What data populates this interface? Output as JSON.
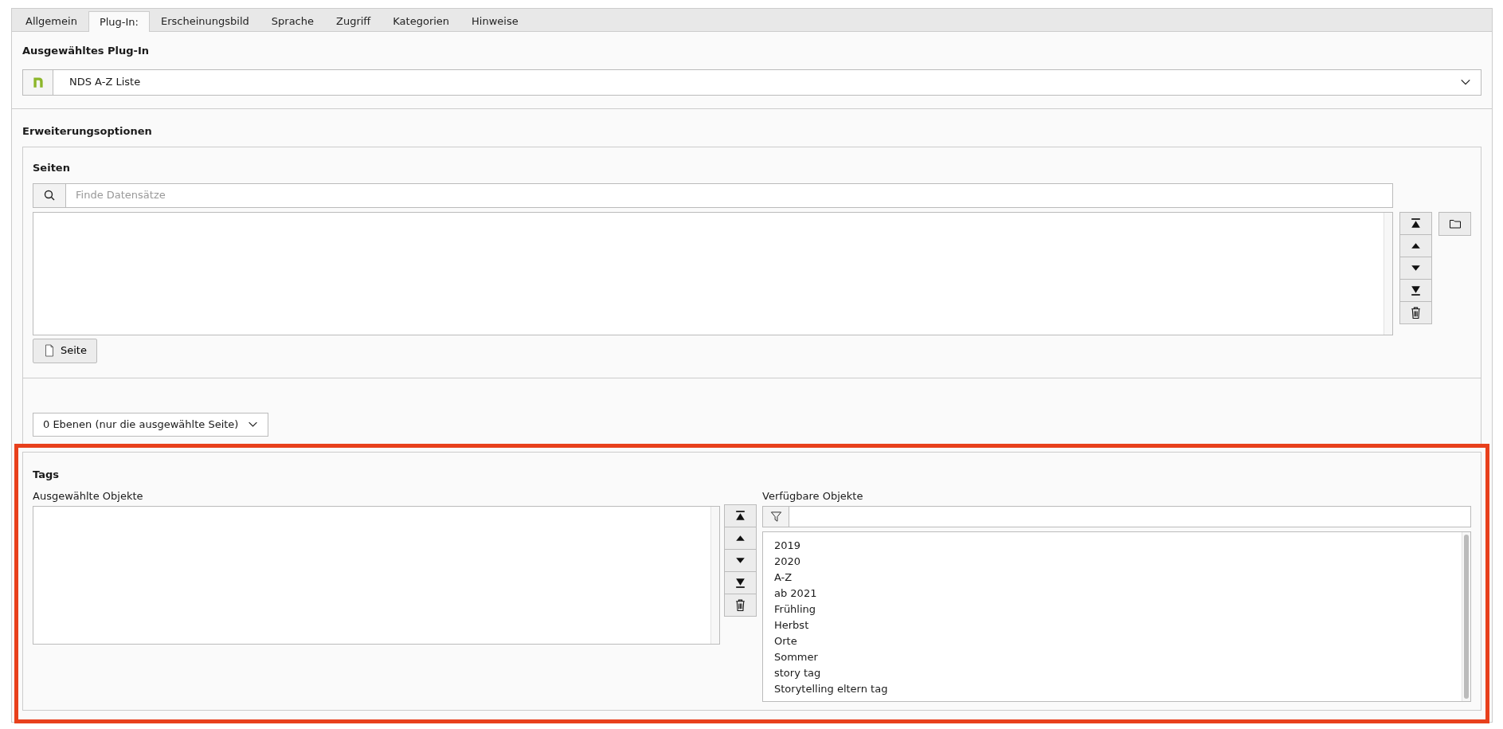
{
  "tabs": [
    {
      "label": "Allgemein",
      "selected": false
    },
    {
      "label": "Plug-In:",
      "selected": true
    },
    {
      "label": "Erscheinungsbild",
      "selected": false
    },
    {
      "label": "Sprache",
      "selected": false
    },
    {
      "label": "Zugriff",
      "selected": false
    },
    {
      "label": "Kategorien",
      "selected": false
    },
    {
      "label": "Hinweise",
      "selected": false
    }
  ],
  "plugin_section": {
    "title": "Ausgewähltes Plug-In",
    "select_value": "NDS A-Z Liste"
  },
  "extension_options": {
    "title": "Erweiterungsoptionen",
    "pages": {
      "label": "Seiten",
      "search": {
        "placeholder": "Finde Datensätze"
      },
      "add_button": "Seite"
    },
    "levels_select": "0 Ebenen (nur die ausgewählte Seite)",
    "tags": {
      "label": "Tags",
      "selected_label": "Ausgewählte Objekte",
      "available_label": "Verfügbare Objekte",
      "available_items": [
        "2019",
        "2020",
        "A-Z",
        "ab 2021",
        "Frühling",
        "Herbst",
        "Orte",
        "Sommer",
        "story tag",
        "Storytelling eltern tag"
      ]
    }
  }
}
